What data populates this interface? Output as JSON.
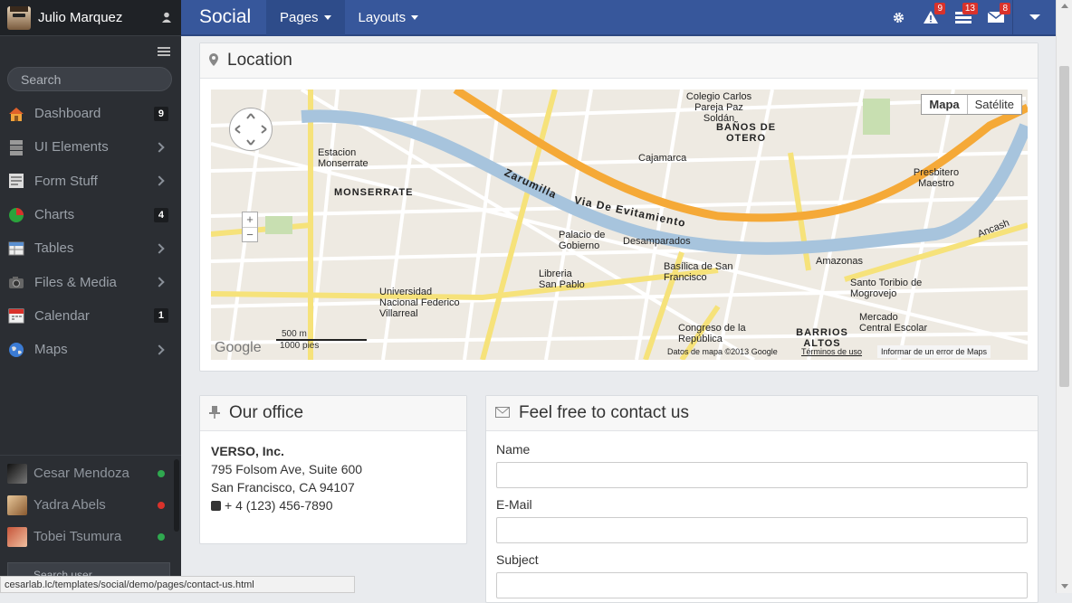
{
  "sidebar": {
    "user_name": "Julio Marquez",
    "search_placeholder": "Search",
    "items": [
      {
        "label": "Dashboard",
        "badge": "9"
      },
      {
        "label": "UI Elements"
      },
      {
        "label": "Form Stuff"
      },
      {
        "label": "Charts",
        "badge": "4"
      },
      {
        "label": "Tables"
      },
      {
        "label": "Files & Media"
      },
      {
        "label": "Calendar",
        "badge": "1"
      },
      {
        "label": "Maps"
      }
    ],
    "contacts": [
      {
        "name": "Cesar Mendoza",
        "status_color": "#2fa84f"
      },
      {
        "name": "Yadra Abels",
        "status_color": "#d9322b"
      },
      {
        "name": "Tobei Tsumura",
        "status_color": "#2fa84f"
      }
    ],
    "search_user_placeholder": "Search user..."
  },
  "topbar": {
    "brand": "Social",
    "menu": [
      {
        "label": "Pages"
      },
      {
        "label": "Layouts"
      }
    ],
    "alerts_count": "9",
    "tasks_count": "13",
    "messages_count": "8"
  },
  "location_panel": {
    "title": "Location",
    "map": {
      "type_buttons": [
        "Mapa",
        "Satélite"
      ],
      "labels": {
        "monserrate": "MONSERRATE",
        "estacion": "Estacion Monserrate",
        "zarumilla": "Zarumilla",
        "via": "Via De Evitamiento",
        "desamparados": "Desamparados",
        "otero": "BAÑOS DE OTERO",
        "barrios": "BARRIOS ALTOS",
        "libreria": "Libreria San Pablo",
        "basilica": "Basílica de San Francisco",
        "universidad": "Universidad Nacional Federico Villarreal",
        "palacio": "Palacio de Gobierno",
        "cajamarca": "Cajamarca",
        "amazonas": "Amazonas",
        "ancash": "Ancash",
        "presbitero": "Presbitero Maestro",
        "santo": "Santo Toribio de Mogrovejo",
        "congreso": "Congreso de la República",
        "colegio": "Colegio Carlos Pareja Paz Soldán",
        "mercado": "Mercado Central Escolar",
        "scale_m": "500 m",
        "scale_ft": "1000 pies",
        "google": "Google",
        "datos": "Datos de mapa ©2013 Google",
        "terminos": "Términos de uso",
        "informar": "Informar de un error de Maps"
      }
    }
  },
  "office_panel": {
    "title": "Our office",
    "company": "VERSO, Inc.",
    "address1": "795 Folsom Ave, Suite 600",
    "address2": "San Francisco, CA 94107",
    "phone": "+ 4 (123) 456-7890"
  },
  "contact_panel": {
    "title": "Feel free to contact us",
    "name_label": "Name",
    "email_label": "E-Mail",
    "subject_label": "Subject"
  },
  "status_bar": {
    "url": "cesarlab.lc/templates/social/demo/pages/contact-us.html"
  }
}
